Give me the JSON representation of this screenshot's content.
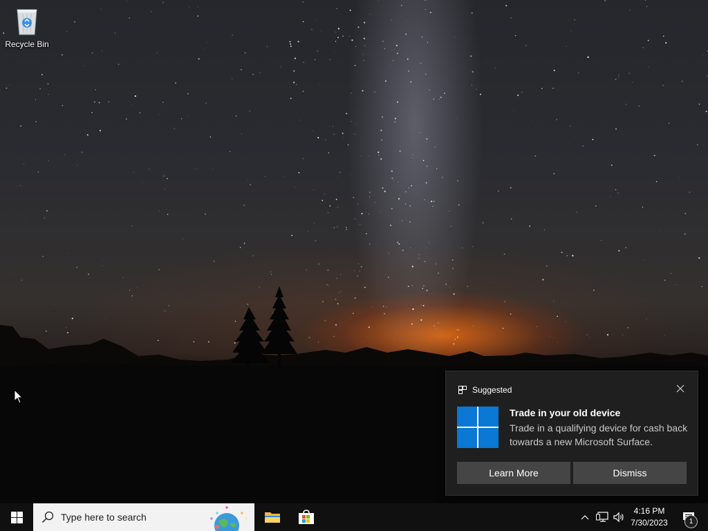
{
  "desktop": {
    "icons": [
      {
        "label": "Recycle Bin",
        "icon": "recycle-bin-icon"
      }
    ]
  },
  "notification": {
    "app_name": "Suggested",
    "app_icon": "suggested-icon",
    "title": "Trade in your old device",
    "body": "Trade in a qualifying device for cash back towards a new Microsoft Surface.",
    "buttons": {
      "learn_more": "Learn More",
      "dismiss": "Dismiss"
    },
    "close_icon": "close-icon"
  },
  "taskbar": {
    "start_icon": "windows-start-icon",
    "search": {
      "placeholder": "Type here to search",
      "icon": "search-icon"
    },
    "pinned_apps": [
      {
        "name": "File Explorer",
        "icon": "folder-icon"
      },
      {
        "name": "Microsoft Store",
        "icon": "store-icon"
      }
    ],
    "tray": {
      "chevron_icon": "chevron-up-icon",
      "network_icon": "network-icon",
      "volume_icon": "volume-icon",
      "time": "4:16 PM",
      "date": "7/30/2023",
      "action_center_icon": "action-center-icon",
      "notification_count": "1"
    }
  },
  "colors": {
    "taskbar": "#101010",
    "toast_background": "#1f1f1f",
    "toast_button": "#454545",
    "windows_blue": "#0a78d4"
  }
}
